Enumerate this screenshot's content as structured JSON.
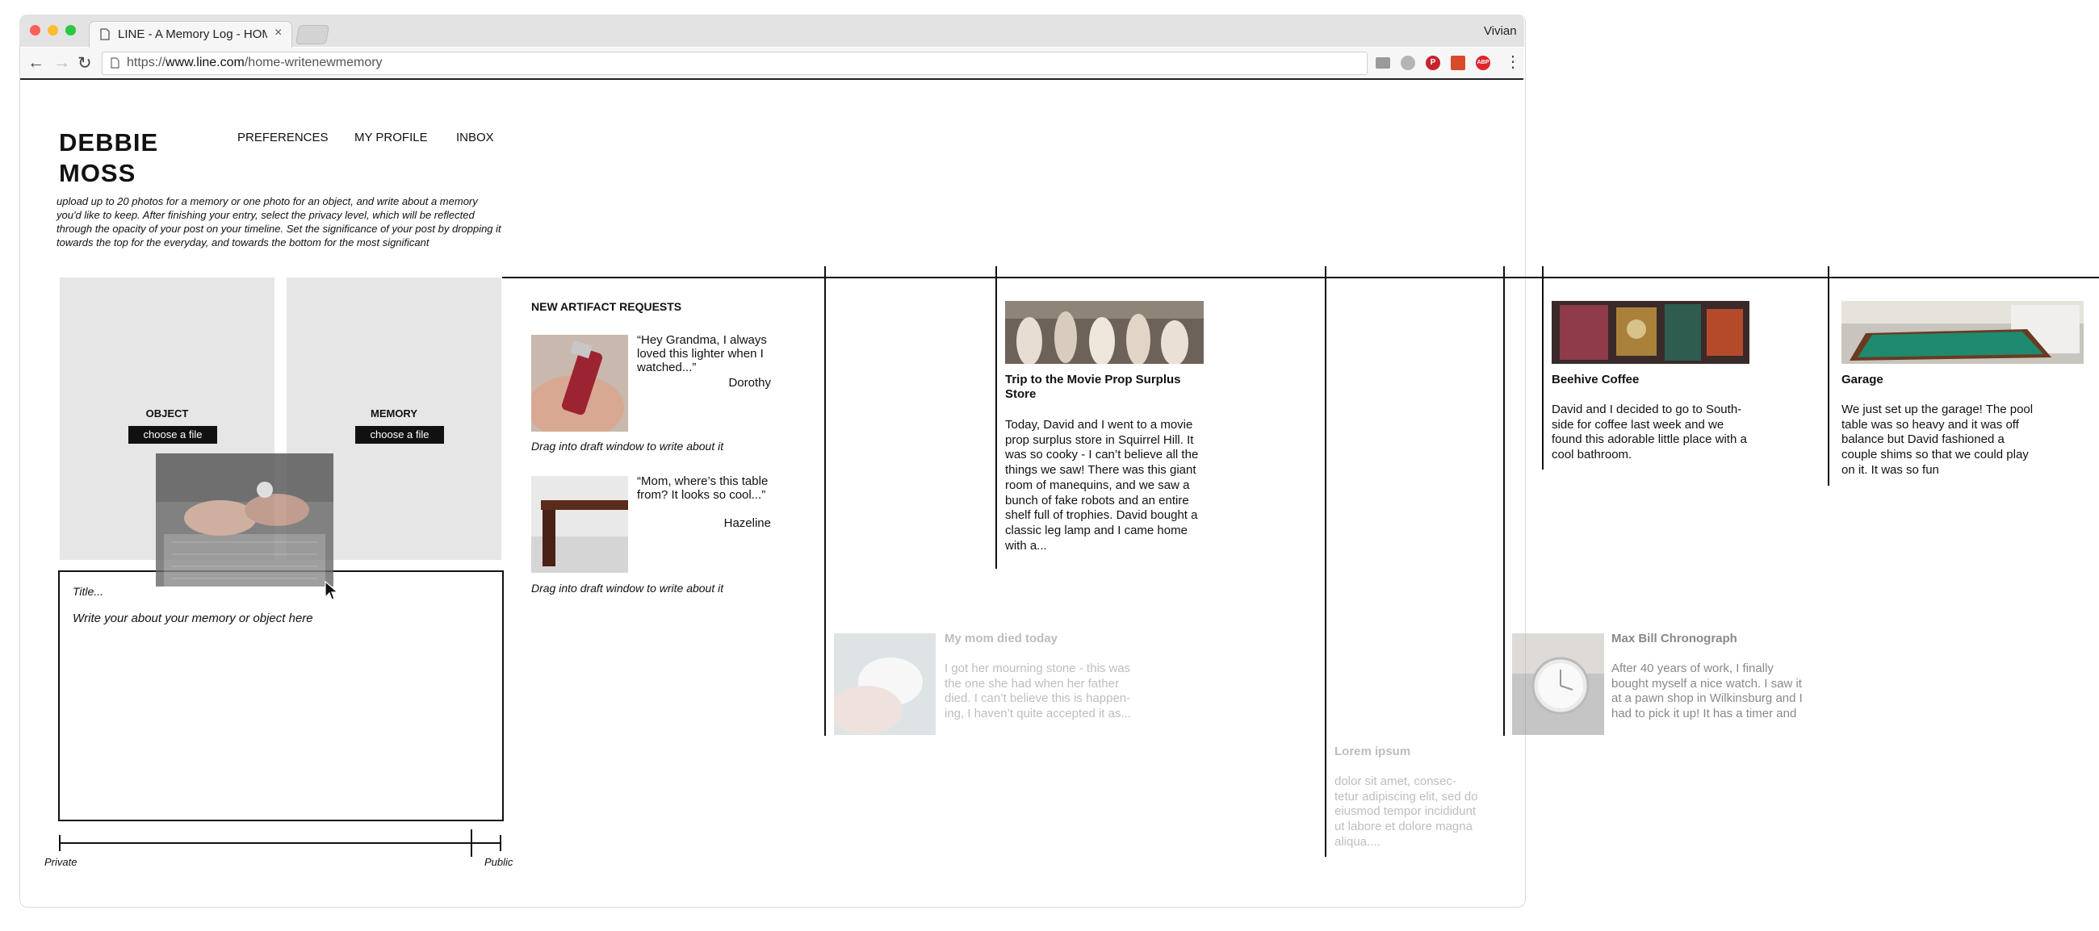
{
  "browser": {
    "tab_title": "LINE - A Memory Log - HOME",
    "tab_close": "×",
    "user": "Vivian",
    "url_scheme": "https://",
    "url_host": "www.line.com",
    "url_path": "/home-writenewmemory",
    "nav": {
      "back": "←",
      "forward": "→",
      "reload": "↻"
    },
    "extensions": [
      {
        "name": "cast-icon",
        "color": "#9a9a9a"
      },
      {
        "name": "cloud-icon",
        "color": "#b5b5b5"
      },
      {
        "name": "pinterest-icon",
        "color": "#c8232c"
      },
      {
        "name": "bookmark-icon",
        "color": "#d94a2b"
      },
      {
        "name": "adblock-icon",
        "color": "#e0242b",
        "label": "ABP"
      }
    ],
    "menu_icon": "⋮"
  },
  "header": {
    "name_line1": "DEBBIE",
    "name_line2": "MOSS",
    "menu": [
      "PREFERENCES",
      "MY PROFILE",
      "INBOX"
    ],
    "instructions": "upload up to 20 photos for a memory or one photo for an object, and write about a memory you'd like to keep. After finishing your entry, select the privacy level, which will be reflected through the opacity of your post on your timeline. Set the significance of your post by dropping it towards the top for the everyday, and towards the bottom for the most significant"
  },
  "upload": {
    "object_label": "OBJECT",
    "memory_label": "MEMORY",
    "choose_file": "choose a file"
  },
  "editor": {
    "title_placeholder": "Title...",
    "body_placeholder": "Write your about your memory or object here"
  },
  "privacy": {
    "private_label": "Private",
    "public_label": "Public",
    "level": 0.93
  },
  "requests": {
    "heading": "NEW ARTIFACT REQUESTS",
    "items": [
      {
        "quote": "“Hey Grandma, I always loved this lighter when I watched...”",
        "from": "Dorothy",
        "hint": "Drag into draft window to write about it"
      },
      {
        "quote": "“Mom, where’s this table from? It looks so cool...”",
        "from": "Hazeline",
        "hint": "Drag into draft window to write about it"
      }
    ]
  },
  "timeline": {
    "posts": [
      {
        "title": "Trip to the Movie Prop Surplus Store",
        "text": "Today, David and I went to a movie prop surplus store in Squirrel Hill. It was so cooky - I can’t believe all the things we saw! There was this giant room of manequins, and we saw a bunch of fake robots and an entire shelf full of trophies. David bought a classic leg lamp and I came home with a..."
      },
      {
        "title": "Beehive Coffee",
        "text": "David and I decided to go to South-side for coffee last week and we found this adorable little place with a cool bathroom."
      },
      {
        "title": "Garage",
        "text": "We just set up the garage! The pool table was so heavy and it was off balance but David fashioned a couple shims so that we could play on it. It was so fun"
      }
    ],
    "faded_posts": [
      {
        "title": "My mom died today",
        "text": "I got her mourning stone - this was the one she had when her father died. I can’t believe this is happen-ing, I haven’t quite accepted it as..."
      },
      {
        "title": "Lorem ipsum",
        "text": "dolor sit amet, consec-tetur adipiscing elit, sed do eiusmod tempor incididunt ut labore et dolore magna aliqua...."
      },
      {
        "title": "Max Bill Chronograph",
        "text": "After 40 years of work, I finally bought myself a nice watch. I saw it at a pawn shop in Wilkinsburg and I had to pick it up! It has a timer and"
      }
    ]
  }
}
